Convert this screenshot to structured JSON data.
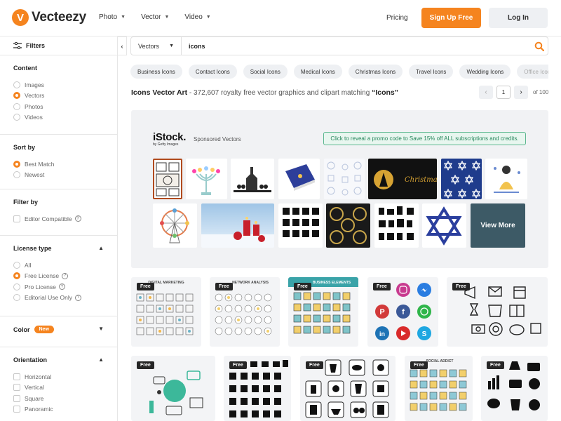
{
  "header": {
    "logo_text": "Vecteezy",
    "nav": [
      "Photo",
      "Vector",
      "Video"
    ],
    "pricing": "Pricing",
    "signup": "Sign Up Free",
    "login": "Log In"
  },
  "sidebar": {
    "filters_label": "Filters",
    "content": {
      "title": "Content",
      "options": [
        "Images",
        "Vectors",
        "Photos",
        "Videos"
      ],
      "selected": "Vectors"
    },
    "sort": {
      "title": "Sort by",
      "options": [
        "Best Match",
        "Newest"
      ],
      "selected": "Best Match"
    },
    "filter": {
      "title": "Filter by",
      "options": [
        "Editor Compatible"
      ]
    },
    "license": {
      "title": "License type",
      "options": [
        "All",
        "Free License",
        "Pro License",
        "Editorial Use Only"
      ],
      "selected": "Free License"
    },
    "color": {
      "title": "Color",
      "badge": "New"
    },
    "orientation": {
      "title": "Orientation",
      "options": [
        "Horizontal",
        "Vertical",
        "Square",
        "Panoramic"
      ]
    }
  },
  "search": {
    "type": "Vectors",
    "query": "icons"
  },
  "tags": [
    "Business Icons",
    "Contact Icons",
    "Social Icons",
    "Medical Icons",
    "Christmas Icons",
    "Travel Icons",
    "Wedding Icons",
    "Office Icons"
  ],
  "results": {
    "title": "Icons Vector Art",
    "subtitle_prefix": "- 372,607 royalty free vector graphics and clipart matching",
    "subtitle_query": "“Icons”",
    "page": "1",
    "of_label": "of 100"
  },
  "promo": {
    "brand": "iStock.",
    "brand_sub": "by Getty Images",
    "sponsored": "Sponsored Vectors",
    "code_text": "Click to reveal a promo code to Save 15% off ALL subscriptions and credits.",
    "view_more": "View More",
    "christmas_text": "Christmas"
  },
  "cards": {
    "free_label": "Free",
    "titles": [
      "DIGITAL MARKETING",
      "NETWORK ANALYSIS",
      "BUSINESS ELEMENTS",
      "SOCIAL ADDICT"
    ]
  },
  "colors": {
    "accent": "#f5841f",
    "promo_green": "#27875c"
  }
}
